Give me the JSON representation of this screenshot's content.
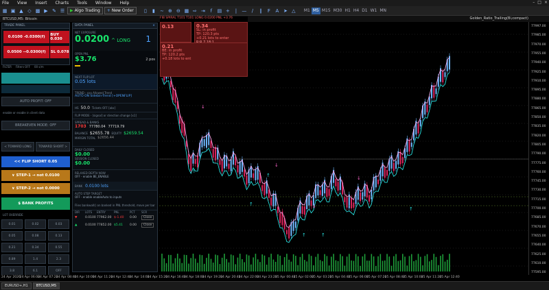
{
  "menu": [
    "File",
    "View",
    "Insert",
    "Charts",
    "Tools",
    "Window",
    "Help"
  ],
  "toolbar": {
    "algo_trading": "Algo Trading",
    "new_order": "New Order",
    "timeframes": [
      "M1",
      "M5",
      "M15",
      "M30",
      "H1",
      "H4",
      "D1",
      "W1",
      "MN"
    ],
    "active_tf": "M5"
  },
  "chart_tab": {
    "symbol": "BTCUSD,M5: Bitcoin",
    "indicator": "Golden_Ratio_Trailing(Bi,compact)"
  },
  "trade_panel": {
    "title": "TRADE PANEL",
    "sell_top": "0.0100 -0.0300(f)",
    "buy_top": "BUY 0.030",
    "sell_mid": "0.0500 --0.0300(f)",
    "buy_mid": "SL 0.078",
    "filter_label": "FILTER",
    "filter_value": "Filters OFF",
    "filter_extra": "00 s/m"
  },
  "left_mid": {
    "auto_profit": "AUTO PROFIT: OFF",
    "auto_profit_sub": "enable or enable in client data",
    "breakeven": "BREAKEVEN MODE: OFF",
    "toward_long": "< TOWARD LONG",
    "toward_short": "TOWARD SHORT >",
    "flip_short": "<< FLIP SHORT  0.05",
    "step1": "∨  STEP-1  → not 0.0100",
    "step2": "∨  STEP-2  → not 0.0000",
    "bank": "$  BANK PROFITS"
  },
  "lot_grid": {
    "title": "LOT OVERRIDE",
    "cells": [
      "0.01",
      "0.02",
      "0.03",
      "0.05",
      "0.08",
      "0.13",
      "0.21",
      "0.34",
      "0.55",
      "0.89",
      "1.4",
      "2.3",
      "3.8",
      "6.1",
      "OFF"
    ]
  },
  "data_panel": {
    "title": "DATA PANEL",
    "net_label": "NET EXPOSURE",
    "net_value": "0.0200",
    "direction": "^ LONG",
    "positions": "1",
    "open_pnl_label": "OPEN PNL",
    "open_pnl": "$3.76",
    "pos_count": "2 pos",
    "next_flip_label": "NEXT FLIP LOT",
    "next_flip": "0.05 lots",
    "trend_label": "TREND - xxx Allowed Trend",
    "trend_value": "AUTO ON  Sidebin-Trend [+OPENFLIP]",
    "hs_label": "HS",
    "hs_value": "50.0",
    "hs_extra": "Tickets OFF   [abc]",
    "flip_mode": "FLIP MODE - [signal] or direction change [x1]",
    "spread_label": "SPREAD & BANKS",
    "sp": "1703",
    "bid": "77780.04",
    "ask": "77719.79",
    "equity_label": "BALANCE",
    "balance": "$2655.78",
    "equity_label2": "EQUITY",
    "equity": "$2659.54",
    "margin_label": "MARGIN TOTAL",
    "margin": "$2656.44",
    "daily_label": "DAILY CLOSED",
    "daily": "$0.00",
    "session_label": "SESSION CLOSED",
    "session": "$0.00",
    "stack_label": "RELAXED DEPTH NOW",
    "stack_value": "OFF - enable BE_ENABLE",
    "bank_row_label": "BANK",
    "bank_row_value": "0.0100 lots",
    "auto_step_label": "AUTO STEP TARGET",
    "auto_step_value": "OFF - enable enableAuto to inputs",
    "note": "Flies bankwall() on banked in PNL threshold, move per bar",
    "table_headers": [
      "DIR",
      "LOTS",
      "ENTRY",
      "PNL",
      "PCT",
      "SCR"
    ],
    "rows": [
      [
        "▼",
        "0.0100",
        "77962.00",
        "$-1.40",
        "0.00",
        "Close"
      ],
      [
        "▲",
        "0.0100",
        "77852.00",
        "$5.41",
        "0.00",
        "Close"
      ]
    ]
  },
  "popups": {
    "line": "FIB SPIRAL  T101  T101  LONG 0.0200  PNL +3.76",
    "p1_a": "0.13",
    "p1_b": "SL: in profit",
    "p1_c": "TP: 120.3 pts",
    "p1_d": "+0.21 lots to enter",
    "p1_e": "R:R  7.18:1",
    "p2_a": "0.21",
    "p2_b": "BE: in profit",
    "p2_c": "TP: 120.2 pts",
    "p2_d": "+0.18 lots to ent",
    "p3_a": "0.34"
  },
  "price_axis": [
    "77997.00",
    "77985.00",
    "77970.00",
    "77955.00",
    "77940.00",
    "77925.00",
    "77910.00",
    "77895.00",
    "77880.00",
    "77865.00",
    "77850.00",
    "77835.00",
    "77820.00",
    "77805.00",
    "77790.00",
    "77775.00",
    "77760.00",
    "77745.00",
    "77730.00",
    "77715.00",
    "77700.00",
    "77685.00",
    "77670.00",
    "77655.00",
    "77640.00",
    "77625.00",
    "77610.00",
    "77595.00"
  ],
  "time_axis": [
    "24 Apr 2026",
    "24 Apr 06:00",
    "24 Apr 07:20",
    "24 Apr 08:40",
    "24 Apr 10:00",
    "24 Apr 11:20",
    "24 Apr 12:40",
    "24 Apr 14:00",
    "24 Apr 15:20",
    "24 Apr 16:40",
    "24 Apr 18:00",
    "24 Apr 19:20",
    "24 Apr 20:40",
    "24 Apr 22:00",
    "24 Apr 23:20",
    "25 Apr 00:40",
    "25 Apr 02:00",
    "25 Apr 03:20",
    "25 Apr 04:40",
    "25 Apr 06:00",
    "25 Apr 07:20",
    "25 Apr 08:40",
    "25 Apr 10:00",
    "25 Apr 11:20",
    "25 Apr 12:40"
  ],
  "bottom_tabs": [
    "EURUSD+,H1",
    "BTCUSD,M5"
  ],
  "colors": {
    "bull": "#6fb8ff",
    "bear": "#e0245e",
    "green": "#19e36b",
    "cyan": "#28e0e0",
    "pink": "#ff66cc"
  }
}
